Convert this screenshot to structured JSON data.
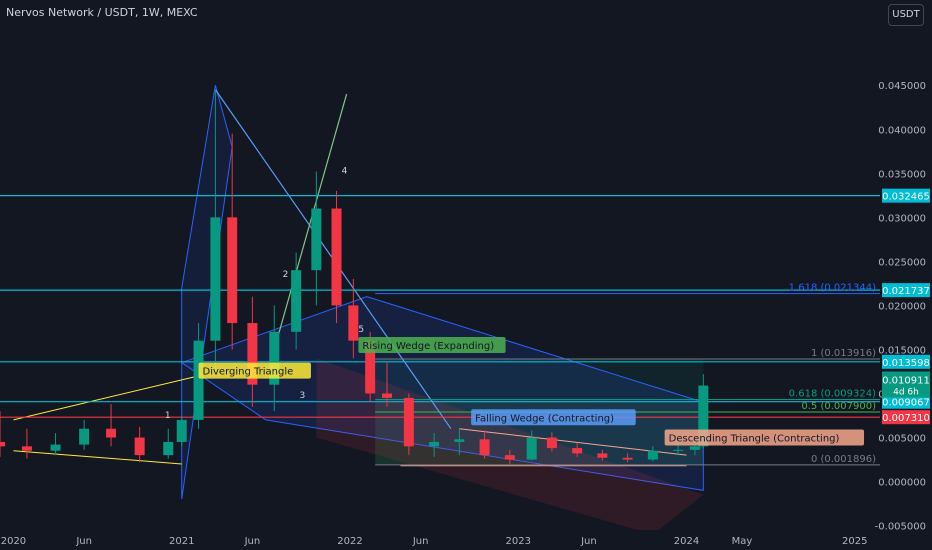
{
  "header": {
    "title": "Nervos Network / USDT, 1W, MEXC",
    "currency_button": "USDT"
  },
  "chart_data": {
    "type": "candlestick",
    "title": "Nervos Network / USDT, 1W, MEXC",
    "ylim": [
      -0.0055,
      0.0515
    ],
    "y_ticks": [
      -0.005,
      0.0,
      0.005,
      0.01,
      0.015,
      0.02,
      0.025,
      0.03,
      0.035,
      0.04,
      0.045
    ],
    "y_tick_labels": [
      "-0.005000",
      "0.000000",
      "0.005000",
      "0.010000",
      "0.015000",
      "0.020000",
      "0.025000",
      "0.030000",
      "0.035000",
      "0.040000",
      "0.045000"
    ],
    "x_tick_labels": [
      {
        "label": "2020",
        "t": 2020.0
      },
      {
        "label": "Jun",
        "t": 2020.42
      },
      {
        "label": "2021",
        "t": 2021.0
      },
      {
        "label": "Jun",
        "t": 2021.42
      },
      {
        "label": "2022",
        "t": 2022.0
      },
      {
        "label": "Jun",
        "t": 2022.42
      },
      {
        "label": "2023",
        "t": 2023.0
      },
      {
        "label": "Jun",
        "t": 2023.42
      },
      {
        "label": "2024",
        "t": 2024.0
      },
      {
        "label": "May",
        "t": 2024.33
      },
      {
        "label": "2025",
        "t": 2025.0
      }
    ],
    "current_price": {
      "value": 0.010911,
      "label": "0.010911",
      "countdown": "4d 6h"
    },
    "horizontal_levels": [
      {
        "value": 0.032465,
        "label": "0.032465",
        "color": "#00bcd4"
      },
      {
        "value": 0.021737,
        "label": "0.021737",
        "color": "#00bcd4"
      },
      {
        "value": 0.013598,
        "label": "0.013598",
        "color": "#00bcd4"
      },
      {
        "value": 0.009067,
        "label": "0.009067",
        "color": "#00bcd4"
      },
      {
        "value": 0.00731,
        "label": "0.007310",
        "color": "#f23645"
      }
    ],
    "fibonacci": [
      {
        "ratio": "1.618",
        "value": 0.021344,
        "label": "1.618 (0.021344)",
        "color": "#2962ff"
      },
      {
        "ratio": "1",
        "value": 0.013916,
        "label": "1 (0.013916)",
        "color": "#787b86"
      },
      {
        "ratio": "0.618",
        "value": 0.009324,
        "label": "0.618 (0.009324)",
        "color": "#089981"
      },
      {
        "ratio": "0.5",
        "value": 0.0079,
        "label": "0.5 (0.007900)",
        "color": "#4caf50"
      },
      {
        "ratio": "0",
        "value": 0.001896,
        "label": "0 (0.001896)",
        "color": "#787b86"
      }
    ],
    "annotations": [
      {
        "text": "Diverging Triangle",
        "t": 2021.1,
        "y": 0.0126,
        "bg": "#ffeb3b",
        "fg": "#131722"
      },
      {
        "text": "Rising Wedge (Expanding)",
        "t": 2022.05,
        "y": 0.0155,
        "bg": "#4caf50",
        "fg": "#131722"
      },
      {
        "text": "Falling Wedge (Contracting)",
        "t": 2022.72,
        "y": 0.0073,
        "bg": "#5b9cf6",
        "fg": "#131722"
      },
      {
        "text": "Descending Triangle (Contracting)",
        "t": 2023.87,
        "y": 0.005,
        "bg": "#f7a78c",
        "fg": "#131722"
      }
    ],
    "wave_labels": [
      "1",
      "2",
      "3",
      "4",
      "5"
    ],
    "candles": [
      {
        "t": 2019.92,
        "o": 0.0045,
        "h": 0.008,
        "l": 0.0028,
        "c": 0.004
      },
      {
        "t": 2020.08,
        "o": 0.004,
        "h": 0.006,
        "l": 0.0026,
        "c": 0.0035
      },
      {
        "t": 2020.25,
        "o": 0.0035,
        "h": 0.0055,
        "l": 0.003,
        "c": 0.0042
      },
      {
        "t": 2020.42,
        "o": 0.0042,
        "h": 0.007,
        "l": 0.0036,
        "c": 0.006
      },
      {
        "t": 2020.58,
        "o": 0.006,
        "h": 0.0088,
        "l": 0.004,
        "c": 0.005
      },
      {
        "t": 2020.75,
        "o": 0.005,
        "h": 0.0062,
        "l": 0.0022,
        "c": 0.003
      },
      {
        "t": 2020.92,
        "o": 0.003,
        "h": 0.006,
        "l": 0.0026,
        "c": 0.0045
      },
      {
        "t": 2021.0,
        "o": 0.0045,
        "h": 0.0075,
        "l": 0.004,
        "c": 0.007
      },
      {
        "t": 2021.1,
        "o": 0.007,
        "h": 0.018,
        "l": 0.006,
        "c": 0.016
      },
      {
        "t": 2021.2,
        "o": 0.016,
        "h": 0.0445,
        "l": 0.012,
        "c": 0.03
      },
      {
        "t": 2021.3,
        "o": 0.03,
        "h": 0.0395,
        "l": 0.015,
        "c": 0.018
      },
      {
        "t": 2021.42,
        "o": 0.018,
        "h": 0.021,
        "l": 0.0085,
        "c": 0.011
      },
      {
        "t": 2021.55,
        "o": 0.011,
        "h": 0.02,
        "l": 0.008,
        "c": 0.017
      },
      {
        "t": 2021.68,
        "o": 0.017,
        "h": 0.026,
        "l": 0.015,
        "c": 0.024
      },
      {
        "t": 2021.8,
        "o": 0.024,
        "h": 0.0352,
        "l": 0.02,
        "c": 0.031
      },
      {
        "t": 2021.92,
        "o": 0.031,
        "h": 0.033,
        "l": 0.018,
        "c": 0.02
      },
      {
        "t": 2022.02,
        "o": 0.02,
        "h": 0.023,
        "l": 0.014,
        "c": 0.016
      },
      {
        "t": 2022.12,
        "o": 0.016,
        "h": 0.017,
        "l": 0.009,
        "c": 0.01
      },
      {
        "t": 2022.22,
        "o": 0.01,
        "h": 0.0135,
        "l": 0.0085,
        "c": 0.0095
      },
      {
        "t": 2022.35,
        "o": 0.0095,
        "h": 0.01,
        "l": 0.003,
        "c": 0.004
      },
      {
        "t": 2022.5,
        "o": 0.004,
        "h": 0.0055,
        "l": 0.0028,
        "c": 0.0045
      },
      {
        "t": 2022.65,
        "o": 0.0045,
        "h": 0.006,
        "l": 0.003,
        "c": 0.0048
      },
      {
        "t": 2022.8,
        "o": 0.0048,
        "h": 0.0058,
        "l": 0.0026,
        "c": 0.003
      },
      {
        "t": 2022.95,
        "o": 0.003,
        "h": 0.0036,
        "l": 0.002,
        "c": 0.0025
      },
      {
        "t": 2023.08,
        "o": 0.0025,
        "h": 0.0058,
        "l": 0.0024,
        "c": 0.005
      },
      {
        "t": 2023.2,
        "o": 0.005,
        "h": 0.0056,
        "l": 0.0034,
        "c": 0.0038
      },
      {
        "t": 2023.35,
        "o": 0.0038,
        "h": 0.0044,
        "l": 0.0028,
        "c": 0.0032
      },
      {
        "t": 2023.5,
        "o": 0.0032,
        "h": 0.0036,
        "l": 0.0024,
        "c": 0.0027
      },
      {
        "t": 2023.65,
        "o": 0.0027,
        "h": 0.0032,
        "l": 0.0022,
        "c": 0.0025
      },
      {
        "t": 2023.8,
        "o": 0.0025,
        "h": 0.004,
        "l": 0.0023,
        "c": 0.0035
      },
      {
        "t": 2023.95,
        "o": 0.0035,
        "h": 0.0044,
        "l": 0.003,
        "c": 0.0036
      },
      {
        "t": 2024.05,
        "o": 0.0036,
        "h": 0.0046,
        "l": 0.003,
        "c": 0.004
      },
      {
        "t": 2024.1,
        "o": 0.004,
        "h": 0.0122,
        "l": 0.0038,
        "c": 0.0109
      }
    ]
  }
}
